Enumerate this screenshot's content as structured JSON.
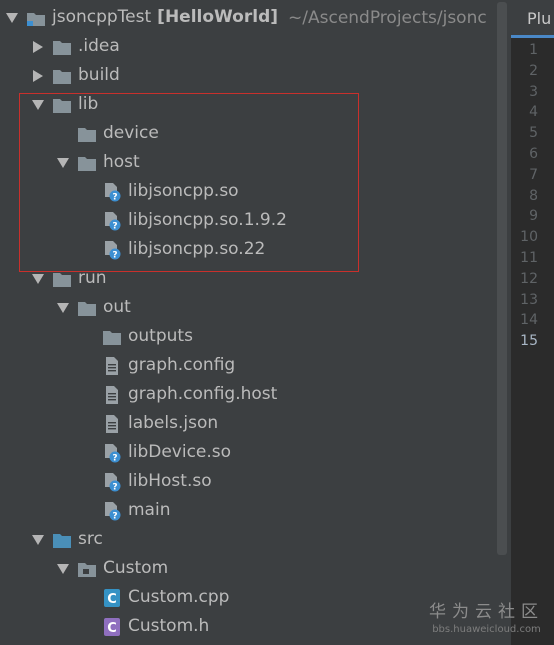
{
  "project": {
    "name": "jsoncppTest",
    "module": "[HelloWorld]",
    "path": "~/AscendProjects/jsonc"
  },
  "tree": [
    {
      "label": ".idea",
      "type": "folder",
      "expanded": false,
      "depth": 1
    },
    {
      "label": "build",
      "type": "folder",
      "expanded": false,
      "depth": 1
    },
    {
      "label": "lib",
      "type": "folder",
      "expanded": true,
      "depth": 1
    },
    {
      "label": "device",
      "type": "folder",
      "expanded": null,
      "depth": 2
    },
    {
      "label": "host",
      "type": "folder",
      "expanded": true,
      "depth": 2
    },
    {
      "label": "libjsoncpp.so",
      "type": "unknown-file",
      "depth": 3
    },
    {
      "label": "libjsoncpp.so.1.9.2",
      "type": "unknown-file",
      "depth": 3
    },
    {
      "label": "libjsoncpp.so.22",
      "type": "unknown-file",
      "depth": 3
    },
    {
      "label": "run",
      "type": "folder",
      "expanded": true,
      "depth": 1
    },
    {
      "label": "out",
      "type": "folder",
      "expanded": true,
      "depth": 2
    },
    {
      "label": "outputs",
      "type": "folder",
      "expanded": null,
      "depth": 3
    },
    {
      "label": "graph.config",
      "type": "text-file",
      "depth": 3
    },
    {
      "label": "graph.config.host",
      "type": "text-file",
      "depth": 3
    },
    {
      "label": "labels.json",
      "type": "text-file",
      "depth": 3
    },
    {
      "label": "libDevice.so",
      "type": "unknown-file",
      "depth": 3
    },
    {
      "label": "libHost.so",
      "type": "unknown-file",
      "depth": 3
    },
    {
      "label": "main",
      "type": "unknown-file",
      "depth": 3
    },
    {
      "label": "src",
      "type": "source-folder",
      "expanded": true,
      "depth": 1
    },
    {
      "label": "Custom",
      "type": "package-folder",
      "expanded": true,
      "depth": 2
    },
    {
      "label": "Custom.cpp",
      "type": "cpp-file",
      "depth": 3
    },
    {
      "label": "Custom.h",
      "type": "header-file",
      "depth": 3
    }
  ],
  "editor": {
    "tab_label": "Plu",
    "line_numbers": [
      "1",
      "2",
      "3",
      "4",
      "5",
      "6",
      "7",
      "8",
      "9",
      "10",
      "11",
      "12",
      "13",
      "14",
      "15"
    ],
    "current_line": "15"
  },
  "watermark": {
    "text": "华为云社区",
    "url": "bbs.huaweicloud.com"
  },
  "colors": {
    "panel_bg": "#3c3f41",
    "editor_bg": "#2b2b2b",
    "text": "#bbbbbb",
    "folder": "#87939a",
    "source_folder": "#4a8fb8",
    "highlight_box": "#c9302c",
    "tab_underline": "#4a88c7"
  }
}
